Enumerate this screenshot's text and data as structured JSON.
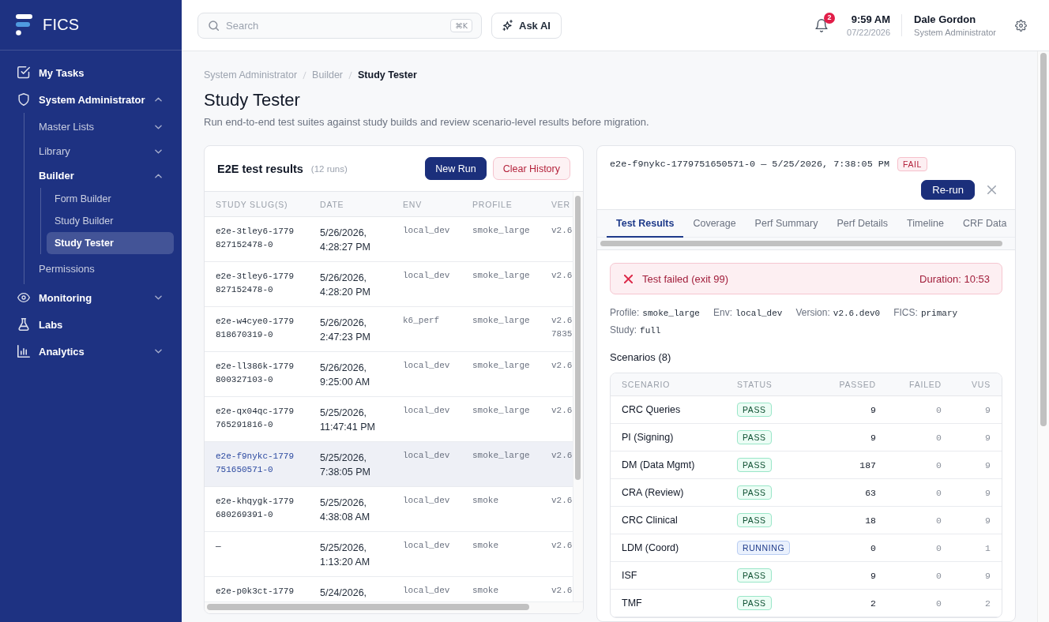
{
  "sidebar": {
    "brand": "FICS",
    "items": [
      {
        "label": "My Tasks",
        "selected": false
      },
      {
        "label": "System Administrator",
        "selected": false,
        "expanded": true,
        "children": [
          {
            "label": "Master Lists",
            "selected": false,
            "expanded": false
          },
          {
            "label": "Library",
            "selected": false,
            "expanded": false
          },
          {
            "label": "Builder",
            "selected": false,
            "expanded": true,
            "children": [
              {
                "label": "Form Builder",
                "selected": false
              },
              {
                "label": "Study Builder",
                "selected": false
              },
              {
                "label": "Study Tester",
                "selected": true
              }
            ]
          },
          {
            "label": "Permissions",
            "selected": false
          }
        ]
      },
      {
        "label": "Monitoring",
        "selected": false,
        "expanded": false
      },
      {
        "label": "Labs",
        "selected": false
      },
      {
        "label": "Analytics",
        "selected": false,
        "expanded": false
      }
    ]
  },
  "header": {
    "search": {
      "placeholder": "Search",
      "shortcut": "⌘K"
    },
    "ask_ai": "Ask AI",
    "notifications": {
      "count": "2"
    },
    "clock": {
      "time": "9:59 AM",
      "date": "07/22/2026"
    },
    "user": {
      "name": "Dale Gordon",
      "role": "System Administrator"
    }
  },
  "breadcrumb": [
    "System Administrator",
    "Builder",
    "Study Tester"
  ],
  "page": {
    "title": "Study Tester",
    "subtitle": "Run end-to-end test suites against study builds and review scenario-level results before migration."
  },
  "runs": {
    "title": "E2E test results",
    "count": "(12 runs)",
    "buttons": [
      {
        "label": "New Run",
        "kind": "primary"
      },
      {
        "label": "Clear History",
        "kind": "danger"
      }
    ],
    "columns": [
      "STUDY SLUG(S)",
      "DATE",
      "ENV",
      "PROFILE",
      "VER"
    ],
    "rows": [
      {
        "study_slugs": "e2e-3tley6-1779827152478-0",
        "date": "5/26/2026, 4:28:27 PM",
        "env": "local_dev",
        "profile": "smoke_large",
        "column_5": "v2.6",
        "selected": false
      },
      {
        "study_slugs": "e2e-3tley6-1779827152478-0",
        "date": "5/26/2026, 4:28:20 PM",
        "env": "local_dev",
        "profile": "smoke_large",
        "column_5": "v2.6",
        "selected": false
      },
      {
        "study_slugs": "e2e-w4cye0-1779818670319-0",
        "date": "5/26/2026, 2:47:23 PM",
        "env": "k6_perf",
        "profile": "smoke_large",
        "column_5": "v2.6 7835",
        "selected": false
      },
      {
        "study_slugs": "e2e-ll386k-1779800327103-0",
        "date": "5/26/2026, 9:25:00 AM",
        "env": "local_dev",
        "profile": "smoke_large",
        "column_5": "v2.6",
        "selected": false
      },
      {
        "study_slugs": "e2e-qx04qc-1779765291816-0",
        "date": "5/25/2026, 11:47:41 PM",
        "env": "local_dev",
        "profile": "smoke_large",
        "column_5": "v2.6",
        "selected": false
      },
      {
        "study_slugs": "e2e-f9nykc-1779751650571-0",
        "date": "5/25/2026, 7:38:05 PM",
        "env": "local_dev",
        "profile": "smoke_large",
        "column_5": "v2.6",
        "selected": true
      },
      {
        "study_slugs": "e2e-khqygk-1779680269391-0",
        "date": "5/25/2026, 4:38:08 AM",
        "env": "local_dev",
        "profile": "smoke",
        "column_5": "v2.6",
        "selected": false
      },
      {
        "study_slugs": "—",
        "date": "5/25/2026, 1:13:20 AM",
        "env": "local_dev",
        "profile": "smoke",
        "column_5": "v2.6",
        "selected": false
      },
      {
        "study_slugs": "e2e-p0k3ct-1779",
        "date": "5/24/2026,",
        "env": "local_dev",
        "profile": "smoke",
        "column_5": "v2.6",
        "selected": false
      }
    ]
  },
  "detail": {
    "title": "e2e-f9nykc-1779751650571-0 — 5/25/2026, 7:38:05 PM",
    "status": {
      "label": "FAIL",
      "kind": "fail"
    },
    "rerun": "Re-run",
    "tabs": [
      {
        "label": "Test Results",
        "selected": true
      },
      {
        "label": "Coverage",
        "selected": false
      },
      {
        "label": "Perf Summary",
        "selected": false
      },
      {
        "label": "Perf Details",
        "selected": false
      },
      {
        "label": "Timeline",
        "selected": false
      },
      {
        "label": "CRF Data",
        "selected": false
      }
    ],
    "alert": {
      "message": "Test failed (exit 99)",
      "duration": "Duration: 10:53"
    },
    "meta": [
      {
        "label": "Profile:",
        "value": "smoke_large"
      },
      {
        "label": "Env:",
        "value": "local_dev"
      },
      {
        "label": "Version:",
        "value": "v2.6.dev0"
      },
      {
        "label": "FICS:",
        "value": "primary"
      },
      {
        "label": "Study:",
        "value": "full"
      }
    ],
    "scenarios": {
      "title": "Scenarios (8)",
      "columns": [
        "SCENARIO",
        "STATUS",
        "PASSED",
        "FAILED",
        "VUS"
      ],
      "rows": [
        {
          "scenario": "CRC Queries",
          "status": {
            "label": "PASS",
            "kind": "pass"
          },
          "passed": "9",
          "failed": "0",
          "vus": "9"
        },
        {
          "scenario": "PI (Signing)",
          "status": {
            "label": "PASS",
            "kind": "pass"
          },
          "passed": "9",
          "failed": "0",
          "vus": "9"
        },
        {
          "scenario": "DM (Data Mgmt)",
          "status": {
            "label": "PASS",
            "kind": "pass"
          },
          "passed": "187",
          "failed": "0",
          "vus": "9"
        },
        {
          "scenario": "CRA (Review)",
          "status": {
            "label": "PASS",
            "kind": "pass"
          },
          "passed": "63",
          "failed": "0",
          "vus": "9"
        },
        {
          "scenario": "CRC Clinical",
          "status": {
            "label": "PASS",
            "kind": "pass"
          },
          "passed": "18",
          "failed": "0",
          "vus": "9"
        },
        {
          "scenario": "LDM (Coord)",
          "status": {
            "label": "RUNNING",
            "kind": "running"
          },
          "passed": "0",
          "failed": "0",
          "vus": "1"
        },
        {
          "scenario": "ISF",
          "status": {
            "label": "PASS",
            "kind": "pass"
          },
          "passed": "9",
          "failed": "0",
          "vus": "9"
        },
        {
          "scenario": "TMF",
          "status": {
            "label": "PASS",
            "kind": "pass"
          },
          "passed": "2",
          "failed": "0",
          "vus": "2"
        }
      ]
    }
  }
}
